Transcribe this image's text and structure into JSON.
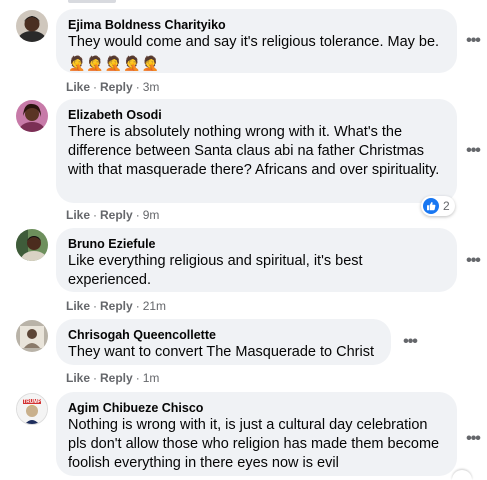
{
  "comments": [
    {
      "author": "Ejima Boldness Charityiko",
      "text": "They would come and say it's religious tolerance. May be.",
      "emojis": "🤦🤦🤦🤦🤦",
      "actions": {
        "like": "Like",
        "reply": "Reply",
        "time": "3m"
      }
    },
    {
      "author": "Elizabeth Osodi",
      "text": "There is absolutely nothing wrong with it. What's the difference between Santa claus abi na father Christmas with that masquerade there? Africans and over spirituality.",
      "actions": {
        "like": "Like",
        "reply": "Reply",
        "time": "9m"
      },
      "reaction_count": "2"
    },
    {
      "author": "Bruno Eziefule",
      "text": "Like everything religious and spiritual, it's best experienced.",
      "actions": {
        "like": "Like",
        "reply": "Reply",
        "time": "21m"
      }
    },
    {
      "author": "Chrisogah Queencollette",
      "text": "They want to convert The Masquerade to Christ",
      "actions": {
        "like": "Like",
        "reply": "Reply",
        "time": "1m"
      }
    },
    {
      "author": "Agim Chibueze Chisco",
      "text": "Nothing is wrong with it, is just a cultural day celebration pls don't allow those who religion has made them become foolish everything in there eyes now is evil",
      "avatar_text": "TRUMP",
      "actions": {}
    }
  ],
  "more_options": "•••",
  "separator": "·",
  "colors": {
    "bubble": "#f0f2f5",
    "meta": "#65676b",
    "like_blue": "#1877f2"
  }
}
